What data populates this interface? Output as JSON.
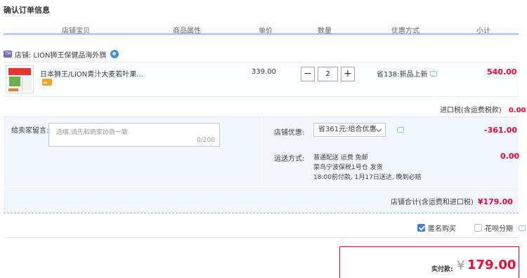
{
  "page_title": "确认订单信息",
  "columns": [
    "店铺宝贝",
    "商品属性",
    "单价",
    "数量",
    "优惠方式",
    "小计"
  ],
  "shop": {
    "tag": "tmall",
    "name": "店铺: LION狮王保健品海外旗",
    "icons": [
      "shop-tag-icon",
      "wangwang-icon"
    ]
  },
  "item": {
    "title": "日本狮王/LION青汁大麦若叶果...",
    "price": "339.00",
    "quantity": "2",
    "minus": "−",
    "plus": "+",
    "discount": "省138:新品上新",
    "subtotal": "540.00"
  },
  "import_tax": {
    "label": "进口税(含运费税款)",
    "value": "0.00"
  },
  "message": {
    "label": "给卖家留言:",
    "placeholder": "选填,请先和商家协商一致",
    "count": "0/200"
  },
  "coupon": {
    "label": "店铺优惠:",
    "selected": "省361元:组合优惠",
    "value": "-361.00"
  },
  "shipping": {
    "label": "运送方式:",
    "line1": "普通配送 运费 免邮",
    "line2": "菜鸟宁波保税1号仓   发货",
    "line3": "18:00前付款, 1月17日送达, 晚到必赔",
    "value": "0.00"
  },
  "shop_total": {
    "label": "店铺合计(含运费和进口税)",
    "value": "¥179.00"
  },
  "options": {
    "anonymous_label": "匿名购买",
    "anonymous_checked": true,
    "huabei_label": "花呗分期",
    "huabei_checked": false
  },
  "payment": {
    "label": "实付款:",
    "currency": "¥",
    "value": "179.00"
  },
  "colors": {
    "accent_red": "#ff0036",
    "panel_blue": "#f2f7ff",
    "header_border": "#b2d1ff",
    "checkbox_blue": "#3a7fe5"
  }
}
